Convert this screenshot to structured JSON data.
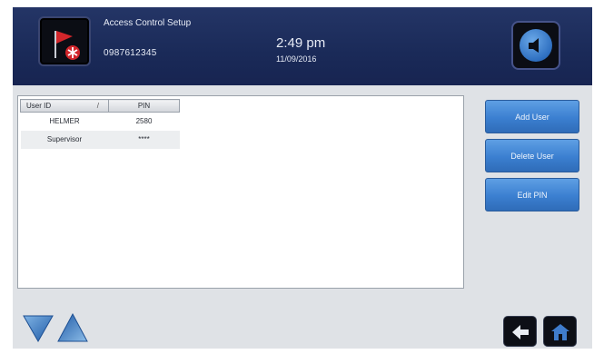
{
  "header": {
    "title": "Access Control Setup",
    "phone": "0987612345",
    "time": "2:49 pm",
    "date": "11/09/2016",
    "alarm_icon": "alarm-flag-icon",
    "sound_icon": "speaker-icon"
  },
  "table": {
    "columns": [
      "User ID",
      "PIN"
    ],
    "sort_indicator": "/",
    "rows": [
      {
        "user_id": "HELMER",
        "pin": "2580"
      },
      {
        "user_id": "Supervisor",
        "pin": "****"
      }
    ]
  },
  "actions": {
    "add_user": "Add User",
    "delete_user": "Delete User",
    "edit_pin": "Edit PIN"
  },
  "navigation": {
    "scroll_down_icon": "arrow-down-icon",
    "scroll_up_icon": "arrow-up-icon",
    "back_icon": "back-icon",
    "home_icon": "home-icon"
  },
  "colors": {
    "header_bg": "#1a2a58",
    "button_blue": "#3b7fd0",
    "alarm_red": "#d2262b"
  }
}
